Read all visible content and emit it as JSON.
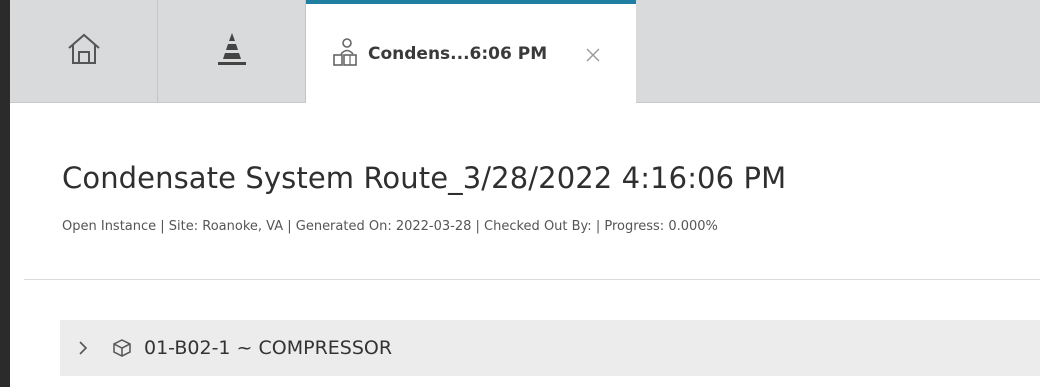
{
  "tabs": [
    {
      "icon": "home-icon"
    },
    {
      "icon": "cone-icon"
    },
    {
      "icon": "route-person-icon",
      "title": "Condens...6:06 PM",
      "active": true,
      "close_icon": "close-icon"
    }
  ],
  "page": {
    "title": "Condensate System Route_3/28/2022 4:16:06 PM",
    "meta": "Open Instance | Site: Roanoke, VA | Generated On: 2022-03-28 | Checked Out By: | Progress: 0.000%"
  },
  "tree": {
    "items": [
      {
        "label": "01-B02-1 ~ COMPRESSOR",
        "icon": "cube-icon",
        "expand_icon": "chevron-right-icon"
      }
    ]
  },
  "colors": {
    "active_tab_accent": "#1f7ea1",
    "tab_bar_bg": "#d9dadb",
    "tree_row_bg": "#ececed"
  }
}
